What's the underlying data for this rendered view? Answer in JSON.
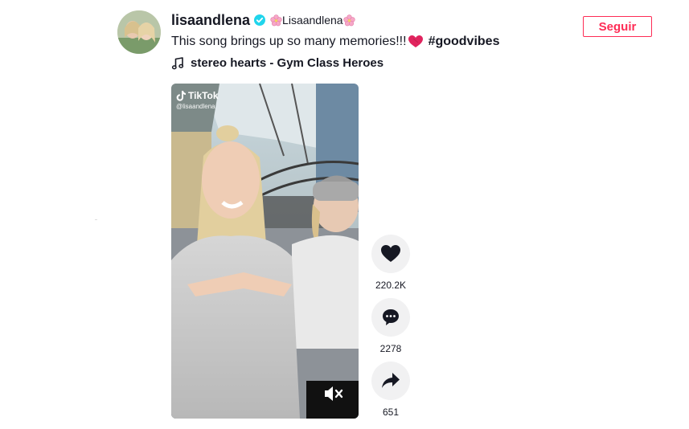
{
  "post": {
    "username": "lisaandlena",
    "nickname": "Lisaandlena",
    "caption": "This song brings up so many memories!!!",
    "hashtag": "#goodvibes",
    "music": "stereo hearts - Gym Class Heroes",
    "follow_label": "Seguir"
  },
  "video": {
    "watermark_brand": "TikTok",
    "watermark_handle": "@lisaandlena"
  },
  "actions": {
    "likes": "220.2K",
    "comments": "2278",
    "shares": "651"
  },
  "icons": {
    "verified": "verified-badge-icon",
    "flower": "cherry-blossom-icon",
    "music": "music-note-icon",
    "like": "heart-icon",
    "comment": "comment-icon",
    "share": "share-arrow-icon",
    "mute": "speaker-muted-icon"
  },
  "colors": {
    "accent": "#fe2c55",
    "verified": "#20d5ec",
    "action_bg": "#f1f1f2"
  }
}
